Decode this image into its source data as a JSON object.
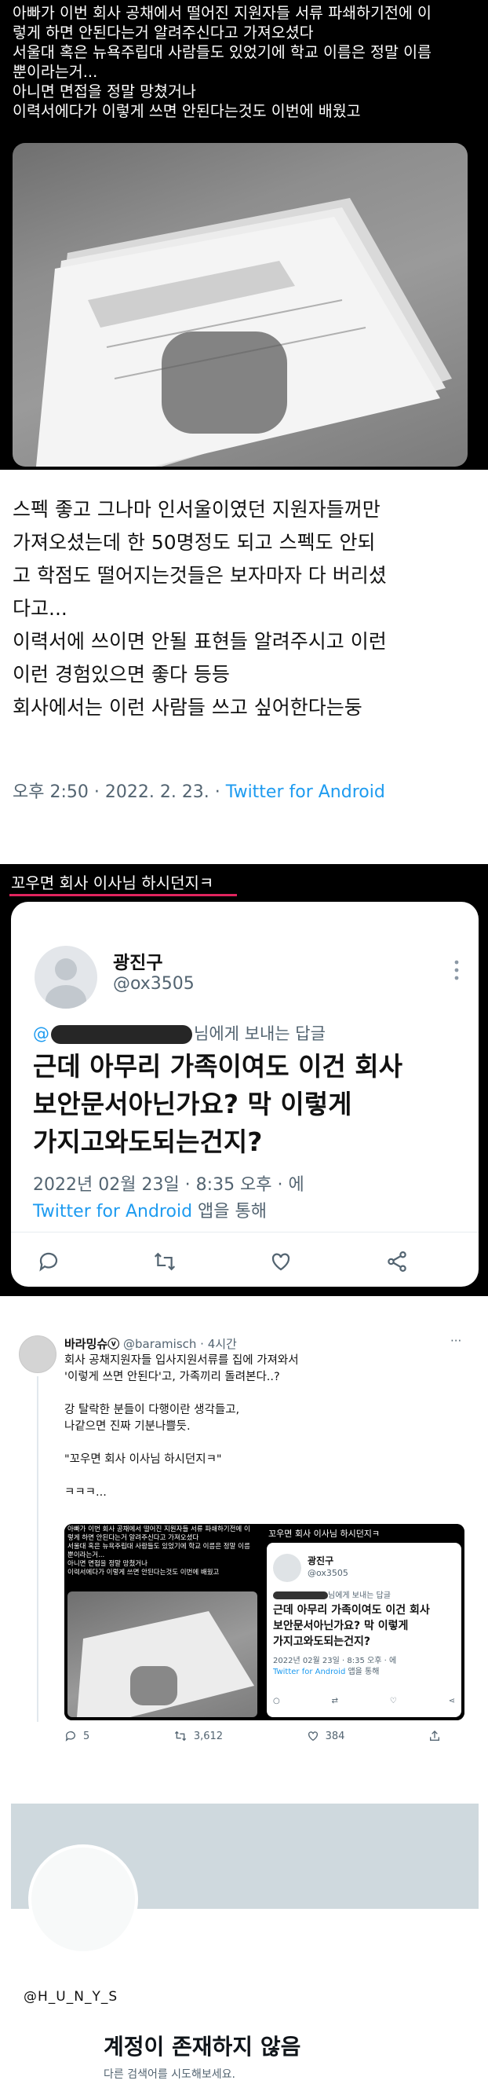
{
  "tweet1": {
    "lines": [
      "아빠가 이번 회사 공채에서 떨어진 지원자들 서류 파쇄하기전에 이",
      "렇게 하면 안된다는거 알려주신다고 가져오셨다",
      "서울대 혹은 뉴욕주립대 사람들도 있었기에 학교 이름은 정말 이름",
      "뿐이라는거...",
      "아니면 면접을 정말 망쳤거나",
      "이력서에다가 이렇게 쓰면 안된다는것도 이번에 배웠고"
    ]
  },
  "tweet2": {
    "lines": [
      "스펙 좋고 그나마 인서울이였던 지원자들꺼만",
      "가져오셨는데 한 50명정도 되고 스펙도 안되",
      "고 학점도 떨어지는것들은 보자마자 다 버리셨",
      "다고...",
      "이력서에 쓰이면 안될 표현들 알려주시고 이런",
      "이런 경험있으면 좋다 등등",
      "회사에서는 이런 사람들 쓰고 싶어한다는둥"
    ],
    "time": "오후 2:50 · 2022. 2. 23. · ",
    "via": "Twitter for Android"
  },
  "reply": {
    "caption": "꼬우면 회사 이사님 하시던지ㅋ",
    "name": "광진구",
    "handle": "@ox3505",
    "replying_prefix": "@",
    "replying_suffix": "님에게 보내는 답글",
    "message": [
      "근데 아무리 가족이여도 이건 회사",
      "보안문서아닌가요? 막 이렇게",
      "가지고와도되는건지?"
    ],
    "time": "2022년 02월 23일 · 8:35 오후 · 에",
    "via": "Twitter for Android",
    "via_suffix": " 앱을 통해"
  },
  "quote": {
    "name": "바라밍슈ⓥ",
    "handle": "@baramisch",
    "age": "4시간",
    "more": "···",
    "lines": [
      "회사 공채지원자들 입사지원서류를 집에 가져와서",
      "'이렇게 쓰면 안된다'고, 가족끼리 돌려본다..?",
      "",
      "강 탈락한 분들이 다행이란 생각들고,",
      "나같으면 진짜 기분나쁠듯.",
      "",
      "\"꼬우면 회사 이사님 하시던지ㅋ\"",
      "",
      "ㅋㅋㅋ..."
    ],
    "embed_left": [
      "아빠가 이번 회사 공채에서 떨어진 지원자들 서류 파쇄하기전에 이",
      "렇게 하면 안된다는거 알려주신다고 가져오셨다",
      "서울대 혹은 뉴욕주립대 사람들도 있었기에 학교 이름은 정말 이름",
      "뿐이라는거...",
      "아니면 면접을 정말 망쳤거나",
      "이력서에다가 이렇게 쓰면 안된다는것도 이번에 배웠고"
    ],
    "embed_right": {
      "caption": "꼬우면 회사 이사님 하시던지ㅋ",
      "name": "광진구",
      "handle": "@ox3505",
      "replying": "님에게 보내는 답글",
      "message": [
        "근데 아무리 가족이여도 이건 회사",
        "보안문서아닌가요? 막 이렇게",
        "가지고와도되는건지?"
      ],
      "time": "2022년 02월 23일 · 8:35 오후 · 에",
      "via": "Twitter for Android",
      "via_suffix": " 앱을 통해"
    },
    "stats": {
      "replies": "5",
      "retweets": "3,612",
      "likes": "384"
    }
  },
  "profile": {
    "handle": "@H_U_N_Y_S",
    "title": "계정이 존재하지 않음",
    "subtitle": "다른 검색어를 시도해보세요."
  }
}
